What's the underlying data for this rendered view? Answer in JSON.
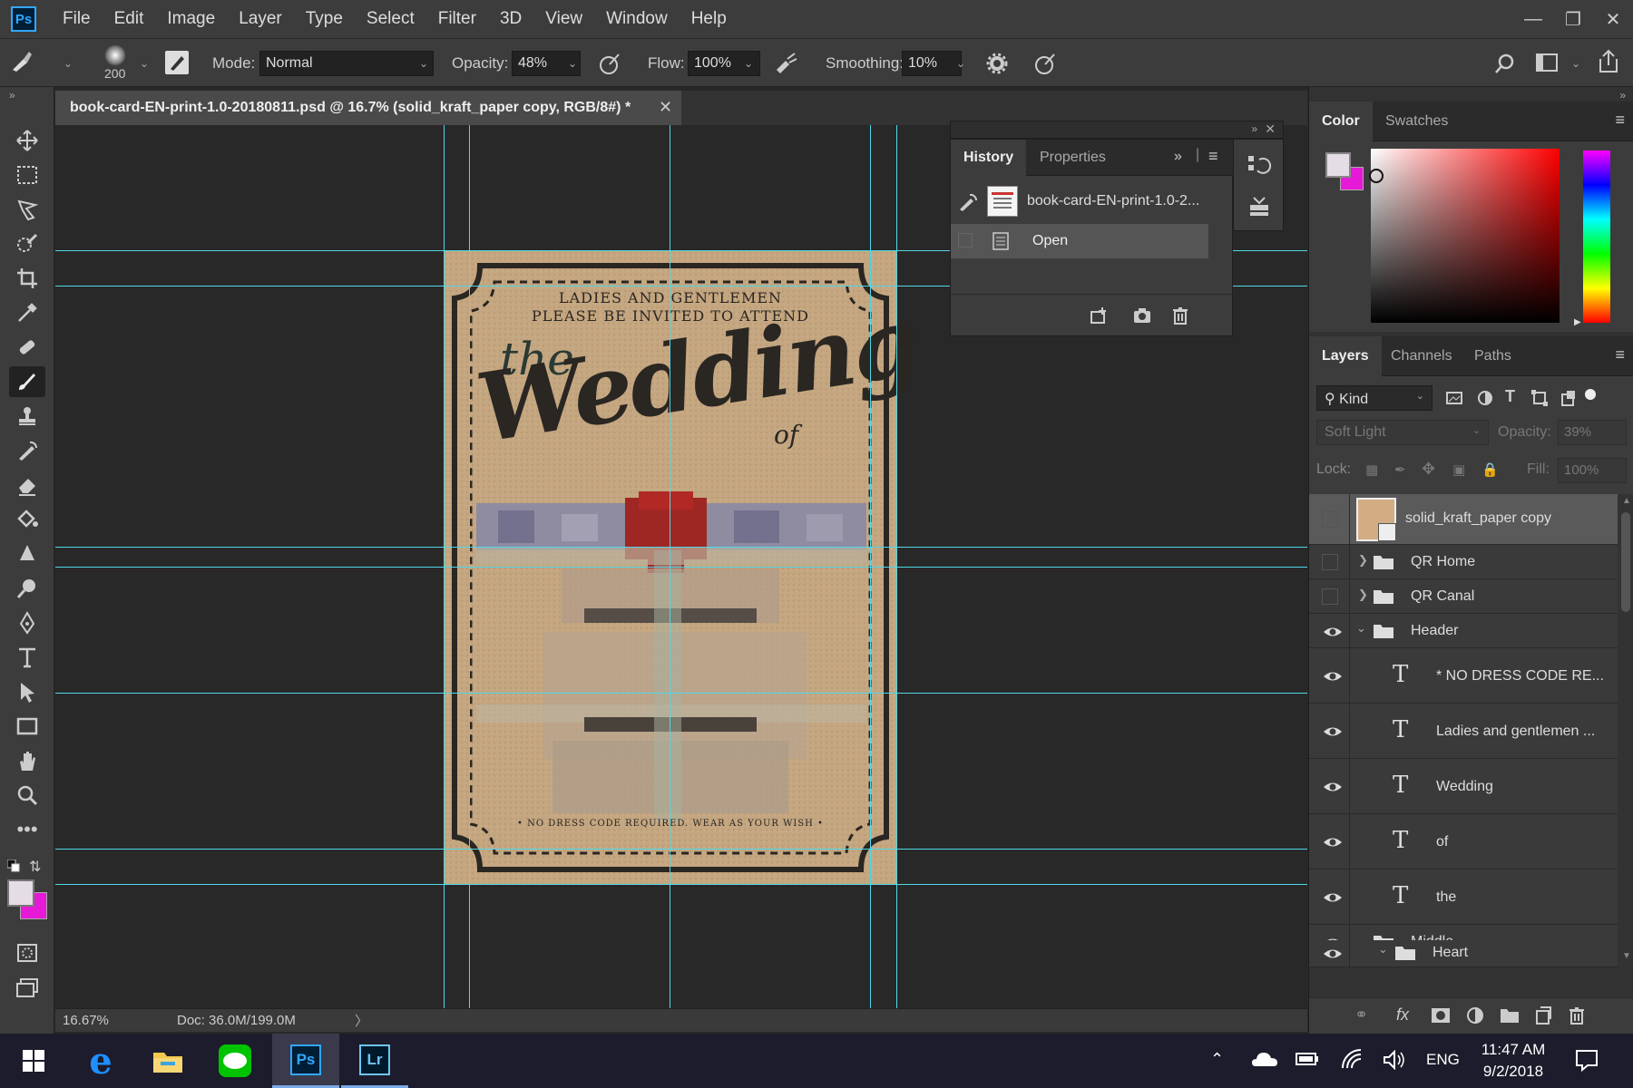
{
  "app": {
    "logo_text": "Ps"
  },
  "menu": [
    "File",
    "Edit",
    "Image",
    "Layer",
    "Type",
    "Select",
    "Filter",
    "3D",
    "View",
    "Window",
    "Help"
  ],
  "options": {
    "brush_size": "200",
    "mode_label": "Mode:",
    "mode_value": "Normal",
    "opacity_label": "Opacity:",
    "opacity_value": "48%",
    "flow_label": "Flow:",
    "flow_value": "100%",
    "smoothing_label": "Smoothing:",
    "smoothing_value": "10%"
  },
  "document": {
    "tab_title": "book-card-EN-print-1.0-20180811.psd @ 16.7% (solid_kraft_paper copy, RGB/8#) *",
    "zoom": "16.67%",
    "doc_info": "Doc: 36.0M/199.0M"
  },
  "card": {
    "line1": "LADIES AND GENTLEMEN",
    "line2": "PLEASE BE INVITED TO ATTEND",
    "the": "the",
    "wedding": "Wedding",
    "of": "of",
    "footer": "• NO DRESS CODE REQUIRED. WEAR AS YOUR WISH •"
  },
  "history_panel": {
    "tabs": [
      "History",
      "Properties"
    ],
    "snapshot_name": "book-card-EN-print-1.0-2...",
    "state": "Open"
  },
  "color_panel": {
    "tabs": [
      "Color",
      "Swatches"
    ]
  },
  "layers_panel": {
    "tabs": [
      "Layers",
      "Channels",
      "Paths"
    ],
    "filter_kind": "Kind",
    "blend_mode": "Soft Light",
    "opacity_label": "Opacity:",
    "opacity_value": "39%",
    "lock_label": "Lock:",
    "fill_label": "Fill:",
    "fill_value": "100%",
    "layers": [
      {
        "name": "solid_kraft_paper copy",
        "type": "image",
        "visible": false,
        "selected": true,
        "indent": 0
      },
      {
        "name": "QR Home",
        "type": "group-closed",
        "visible": false,
        "indent": 0
      },
      {
        "name": "QR Canal",
        "type": "group-closed",
        "visible": false,
        "indent": 0
      },
      {
        "name": "Header",
        "type": "group-open",
        "visible": true,
        "indent": 0
      },
      {
        "name": "* NO DRESS CODE RE...",
        "type": "text",
        "visible": true,
        "indent": 1
      },
      {
        "name": "Ladies and gentlemen ...",
        "type": "text",
        "visible": true,
        "indent": 1
      },
      {
        "name": "Wedding",
        "type": "text",
        "visible": true,
        "indent": 1
      },
      {
        "name": "of",
        "type": "text",
        "visible": true,
        "indent": 1
      },
      {
        "name": "the",
        "type": "text",
        "visible": true,
        "indent": 1
      },
      {
        "name": "Middle",
        "type": "group-open",
        "visible": true,
        "indent": 0
      },
      {
        "name": "Heart",
        "type": "group-open",
        "visible": true,
        "indent": 1
      }
    ]
  },
  "taskbar": {
    "time": "11:47 AM",
    "date": "9/2/2018",
    "lang": "ENG",
    "ps_label": "Ps",
    "lr_label": "Lr"
  },
  "colors": {
    "foreground": "#e5dde5",
    "background": "#e619d6",
    "guide": "#4fd8e8",
    "paper": "#c4a680"
  }
}
